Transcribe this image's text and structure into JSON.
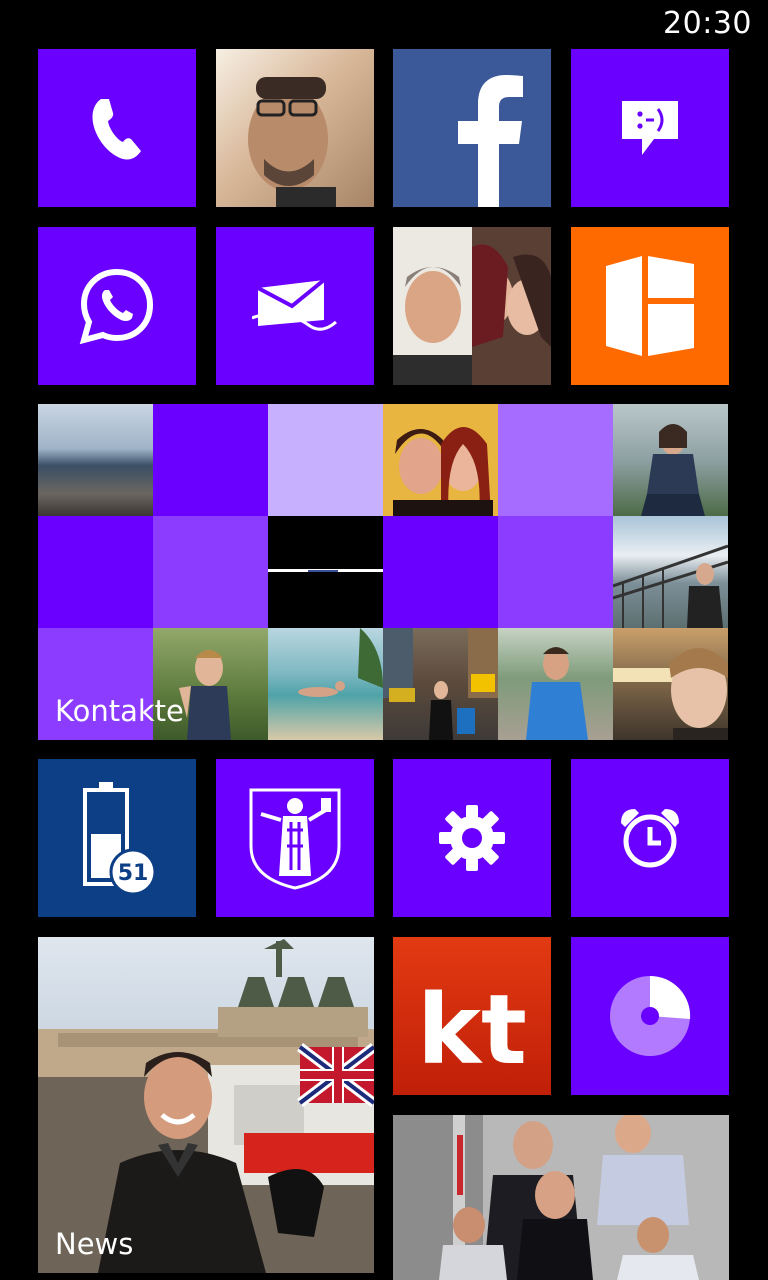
{
  "status_bar": {
    "time": "20:30"
  },
  "colors": {
    "accent": "#6a00ff",
    "facebook": "#3b5998",
    "office_orange": "#ff6a00",
    "battery_blue": "#0d3f86",
    "kt_red": "#cc2200"
  },
  "tiles": [
    {
      "name": "phone-tile",
      "icon": "phone-icon"
    },
    {
      "name": "profile-photo-tile",
      "icon": "photo"
    },
    {
      "name": "facebook-tile",
      "icon": "facebook-icon"
    },
    {
      "name": "messaging-tile",
      "icon": "smiley-message-icon"
    },
    {
      "name": "whatsapp-tile",
      "icon": "whatsapp-icon"
    },
    {
      "name": "outlook-mail-tile",
      "icon": "outlook-mail-icon"
    },
    {
      "name": "people-photos-tile",
      "icon": "photo"
    },
    {
      "name": "office-tile",
      "icon": "office-icon"
    },
    {
      "name": "contacts-hub-tile",
      "label": "Kontakte"
    },
    {
      "name": "battery-tile",
      "icon": "battery-icon",
      "battery_level": "51"
    },
    {
      "name": "munich-app-tile",
      "icon": "munich-coat-of-arms-icon"
    },
    {
      "name": "settings-tile",
      "icon": "gear-icon"
    },
    {
      "name": "alarms-tile",
      "icon": "alarm-clock-icon"
    },
    {
      "name": "news-tile",
      "label": "News"
    },
    {
      "name": "kicker-tile",
      "icon": "kt-logo",
      "logo_text": "kt"
    },
    {
      "name": "data-sense-tile",
      "icon": "pie-chart-icon"
    },
    {
      "name": "sports-photo-tile",
      "icon": "photo"
    }
  ]
}
